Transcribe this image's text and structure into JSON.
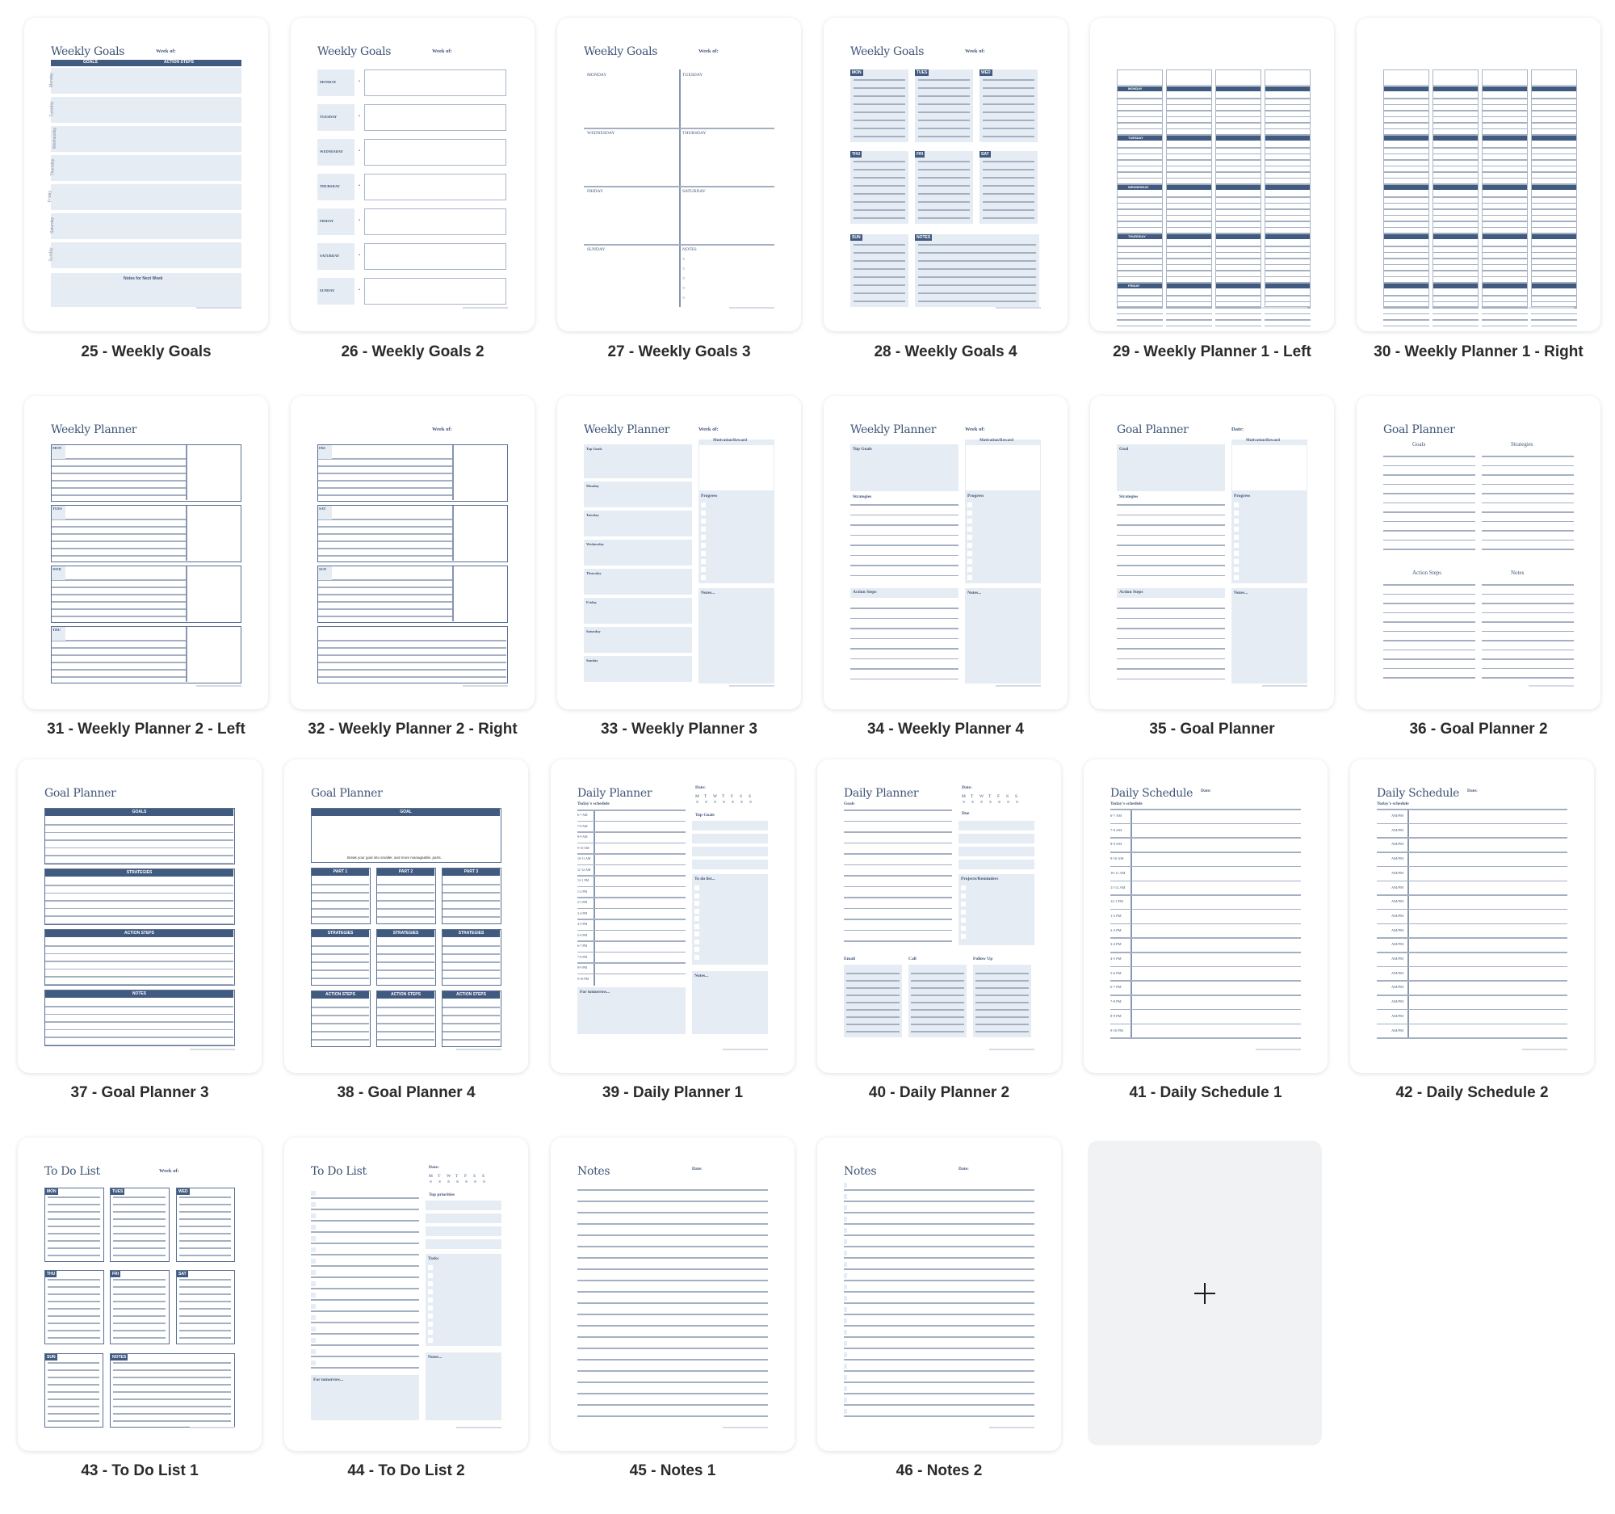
{
  "colors": {
    "navy": "#405a80",
    "light_fill": "#e6ecf3",
    "line": "#a4b0c2",
    "add_card_bg": "#f1f2f4"
  },
  "add_page": {
    "icon": "plus-icon"
  },
  "pages": [
    {
      "number": 25,
      "label": "25 - Weekly Goals",
      "title": "Weekly Goals",
      "week_of": "Week of:",
      "headers": [
        "GOALS",
        "ACTION STEPS"
      ],
      "days": [
        "Monday",
        "Tuesday",
        "Wednesday",
        "Thursday",
        "Friday",
        "Saturday",
        "Sunday"
      ],
      "notes_label": "Notes for Next Week"
    },
    {
      "number": 26,
      "label": "26 - Weekly Goals 2",
      "title": "Weekly Goals",
      "week_of": "Week of:",
      "days": [
        "MONDAY",
        "TUESDAY",
        "WEDNESDAY",
        "THURSDAY",
        "FRIDAY",
        "SATURDAY",
        "SUNDAY"
      ]
    },
    {
      "number": 27,
      "label": "27 - Weekly Goals 3",
      "title": "Weekly Goals",
      "week_of": "Week of:",
      "cells": [
        "MONDAY",
        "TUESDAY",
        "WEDNESDAY",
        "THURSDAY",
        "FRIDAY",
        "SATURDAY",
        "SUNDAY",
        "NOTES"
      ]
    },
    {
      "number": 28,
      "label": "28 - Weekly Goals 4",
      "title": "Weekly Goals",
      "week_of": "Week of:",
      "tags": [
        "MON",
        "TUES",
        "WED",
        "THU",
        "FRI",
        "SAT",
        "SUN",
        "NOTES"
      ]
    },
    {
      "number": 29,
      "label": "29 - Weekly Planner 1 - Left",
      "days": [
        "MONDAY",
        "TUESDAY",
        "WEDNESDAY",
        "THURSDAY",
        "FRIDAY"
      ]
    },
    {
      "number": 30,
      "label": "30 - Weekly Planner 1 - Right"
    },
    {
      "number": 31,
      "label": "31 - Weekly Planner 2 - Left",
      "title": "Weekly Planner",
      "days": [
        "MON",
        "TUES",
        "WED",
        "THU"
      ]
    },
    {
      "number": 32,
      "label": "32 - Weekly Planner 2 - Right",
      "week_of": "Week of:",
      "days": [
        "FRI",
        "SAT",
        "SUN"
      ]
    },
    {
      "number": 33,
      "label": "33 - Weekly Planner 3",
      "title": "Weekly Planner",
      "week_of": "Week of:",
      "sections": [
        "Top Goals",
        "Monday",
        "Tuesday",
        "Wednesday",
        "Thursday",
        "Friday",
        "Saturday",
        "Sunday"
      ],
      "right": [
        "Motivation/Reward",
        "Progress",
        "Notes..."
      ]
    },
    {
      "number": 34,
      "label": "34 - Weekly Planner 4",
      "title": "Weekly Planner",
      "week_of": "Week of:",
      "sections": [
        "Top Goals",
        "Strategies",
        "Action Steps"
      ],
      "right": [
        "Motivation/Reward",
        "Progress",
        "Notes..."
      ]
    },
    {
      "number": 35,
      "label": "35 - Goal Planner",
      "title": "Goal Planner",
      "date": "Date:",
      "sections": [
        "Goal",
        "Strategies",
        "Action Steps"
      ],
      "right": [
        "Motivation/Reward",
        "Progress",
        "Notes..."
      ]
    },
    {
      "number": 36,
      "label": "36 - Goal Planner 2",
      "title": "Goal Planner",
      "columns": [
        "Goals",
        "Strategies",
        "Action Steps",
        "Notes"
      ]
    },
    {
      "number": 37,
      "label": "37 - Goal Planner 3",
      "title": "Goal Planner",
      "sections": [
        "GOALS",
        "STRATEGIES",
        "ACTION STEPS",
        "NOTES"
      ]
    },
    {
      "number": 38,
      "label": "38 - Goal Planner 4",
      "title": "Goal Planner",
      "goal": "GOAL",
      "hint": "Break your goal into smaller, and more manageable, parts.",
      "parts": [
        "PART 1",
        "PART 2",
        "PART 3"
      ],
      "strategies": "STRATEGIES",
      "action_steps": "ACTION STEPS"
    },
    {
      "number": 39,
      "label": "39 - Daily Planner 1",
      "title": "Daily Planner",
      "date": "Date:",
      "weekdays": [
        "M",
        "T",
        "W",
        "T",
        "F",
        "S",
        "S"
      ],
      "schedule_label": "Today's schedule",
      "times": [
        "6-7 AM",
        "7-8 AM",
        "8-9 AM",
        "9-10 AM",
        "10-11 AM",
        "11-12 AM",
        "12-1 PM",
        "1-2 PM",
        "2-3 PM",
        "3-4 PM",
        "4-5 PM",
        "5-6 PM",
        "6-7 PM",
        "7-8 PM",
        "8-9 PM",
        "9-10 PM"
      ],
      "right": [
        "Top Goals",
        "To do list...",
        "Notes..."
      ],
      "tomorrow": "For tomorrow..."
    },
    {
      "number": 40,
      "label": "40 - Daily Planner 2",
      "title": "Daily Planner",
      "date": "Date:",
      "weekdays": [
        "M",
        "T",
        "W",
        "T",
        "F",
        "S",
        "S"
      ],
      "goals": "Goals",
      "due": "Due",
      "projects": "Projects/Reminders",
      "bottom": [
        "Email",
        "Call",
        "Follow Up"
      ]
    },
    {
      "number": 41,
      "label": "41 - Daily Schedule 1",
      "title": "Daily Schedule",
      "date": "Date:",
      "schedule_label": "Today's schedule",
      "times": [
        "6-7 AM",
        "7-8 AM",
        "8-9 AM",
        "9-10 AM",
        "10-11 AM",
        "11-12 AM",
        "12-1 PM",
        "1-2 PM",
        "2-3 PM",
        "3-4 PM",
        "4-5 PM",
        "5-6 PM",
        "6-7 PM",
        "7-8 PM",
        "8-9 PM",
        "9-10 PM"
      ]
    },
    {
      "number": 42,
      "label": "42 - Daily Schedule 2",
      "title": "Daily Schedule",
      "date": "Date:",
      "schedule_label": "Today's schedule",
      "slot": "AM/PM",
      "rows": 16
    },
    {
      "number": 43,
      "label": "43 - To Do List 1",
      "title": "To Do List",
      "week_of": "Week of:",
      "tags": [
        "MON",
        "TUES",
        "WED",
        "THU",
        "FRI",
        "SAT",
        "SUN",
        "NOTES"
      ]
    },
    {
      "number": 44,
      "label": "44 - To Do List 2",
      "title": "To Do List",
      "date": "Date:",
      "weekdays": [
        "M",
        "T",
        "W",
        "T",
        "F",
        "S",
        "S"
      ],
      "right": [
        "Top priorities",
        "Tasks",
        "Notes..."
      ],
      "tomorrow": "For tomorrow..."
    },
    {
      "number": 45,
      "label": "45 - Notes 1",
      "title": "Notes",
      "date": "Date:"
    },
    {
      "number": 46,
      "label": "46 - Notes 2",
      "title": "Notes",
      "date": "Date:"
    }
  ]
}
